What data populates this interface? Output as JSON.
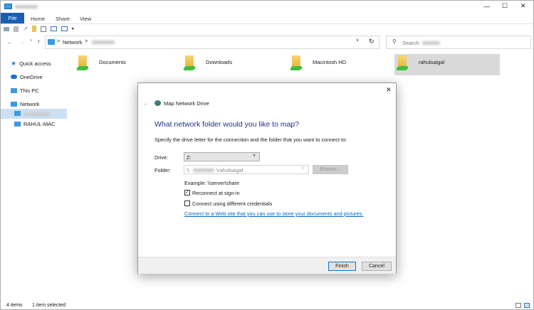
{
  "ribbon": {
    "file": "File",
    "tabs": [
      "Home",
      "Share",
      "View"
    ]
  },
  "address": {
    "crumb": "Network",
    "separator": ">",
    "search_placeholder": "Search"
  },
  "sidebar": {
    "items": [
      "Quick access",
      "OneDrive",
      "This PC",
      "Network",
      "RAHUL-MAC"
    ]
  },
  "folders": [
    "Documents",
    "Downloads",
    "Macintosh HD",
    "rahulsaigal"
  ],
  "status": {
    "items": "4 items",
    "selected": "1 item selected"
  },
  "dialog": {
    "title": "Map Network Drive",
    "heading": "What network folder would you like to map?",
    "instructions": "Specify the drive letter for the connection and the folder that you want to connect to:",
    "drive_label": "Drive:",
    "drive_value": "Z:",
    "folder_label": "Folder:",
    "folder_prefix": "\\\\",
    "folder_suffix": "\\rahulsaigal",
    "browse": "Browse...",
    "example": "Example: \\\\server\\share",
    "reconnect": "Reconnect at sign-in",
    "reconnect_checked": true,
    "credentials": "Connect using different credentials",
    "credentials_checked": false,
    "link": "Connect to a Web site that you can use to store your documents and pictures.",
    "finish": "Finish",
    "cancel": "Cancel",
    "heading_color": "#1e3287",
    "link_color": "#0066cc"
  }
}
